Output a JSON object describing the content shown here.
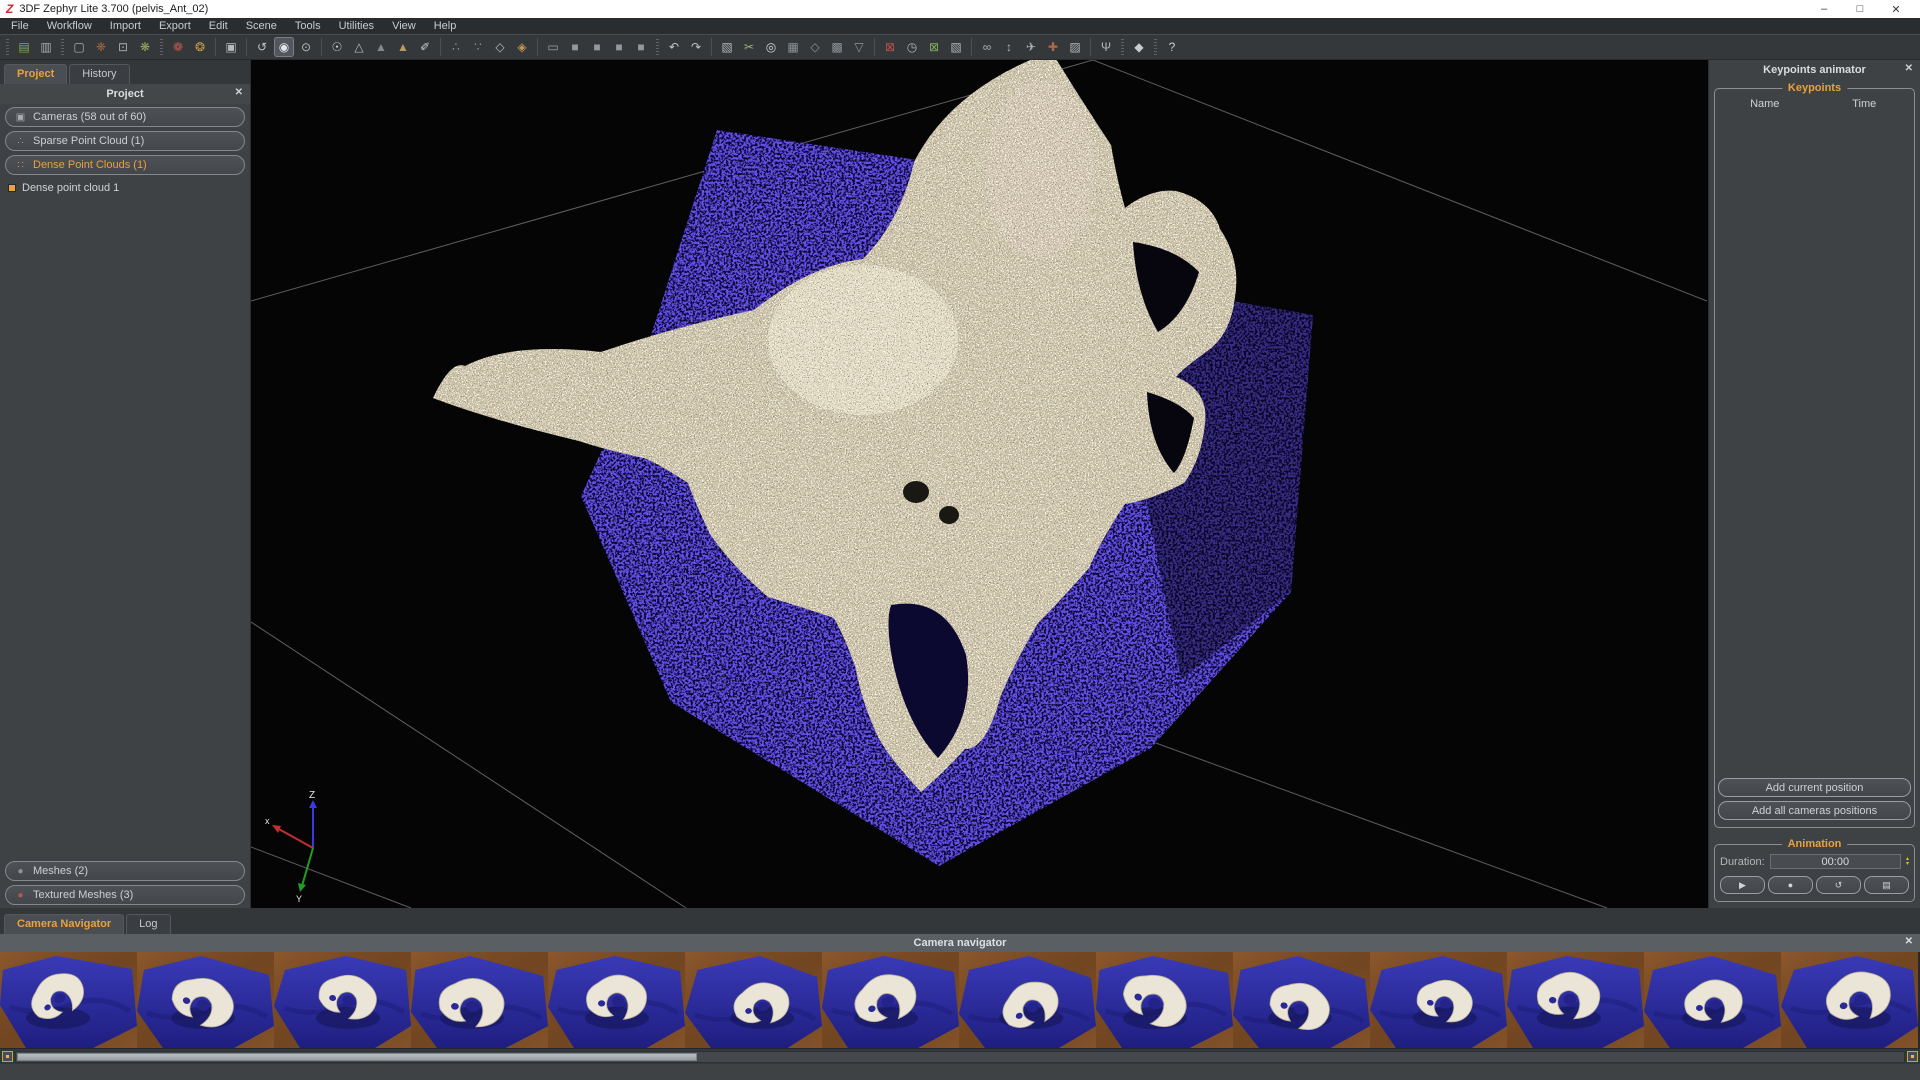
{
  "window": {
    "logo_text": "Z",
    "title": "3DF Zephyr Lite 3.700 (pelvis_Ant_02)",
    "minimize": "–",
    "restore": "□",
    "close": "✕"
  },
  "menu": {
    "items": [
      "File",
      "Workflow",
      "Import",
      "Export",
      "Edit",
      "Scene",
      "Tools",
      "Utilities",
      "View",
      "Help"
    ]
  },
  "toolbar": {
    "items": [
      {
        "type": "handle"
      },
      {
        "name": "open-project-icon",
        "glyph": "▤",
        "color": "#7fae5e"
      },
      {
        "name": "save-project-icon",
        "glyph": "▥",
        "color": "#a9adb0"
      },
      {
        "type": "handle"
      },
      {
        "name": "new-selection-icon",
        "glyph": "▢",
        "color": "#a9adb0"
      },
      {
        "name": "sparse-generation-icon",
        "glyph": "❈",
        "color": "#b9743f"
      },
      {
        "name": "dense-generation-icon",
        "glyph": "⊡",
        "color": "#a9adb0"
      },
      {
        "name": "mesh-generation-icon",
        "glyph": "❋",
        "color": "#97a85c"
      },
      {
        "type": "handle"
      },
      {
        "name": "texture-generation-icon",
        "glyph": "❁",
        "color": "#bf5a4a"
      },
      {
        "name": "stereo-pair-icon",
        "glyph": "❂",
        "color": "#c39a4a"
      },
      {
        "type": "sep"
      },
      {
        "name": "screenshot-camera-icon",
        "glyph": "▣",
        "color": "#b6babd"
      },
      {
        "type": "sep"
      },
      {
        "name": "rotate-view-icon",
        "glyph": "↺",
        "color": "#c0c4c7"
      },
      {
        "name": "orbit-mode-icon",
        "glyph": "◉",
        "color": "#e2e6e9",
        "active": true
      },
      {
        "name": "pan-mode-icon",
        "glyph": "⊙",
        "color": "#b6babd"
      },
      {
        "type": "sep"
      },
      {
        "name": "lightbulb-icon",
        "glyph": "☉",
        "color": "#c8cccf"
      },
      {
        "name": "render-points-icon",
        "glyph": "△",
        "color": "#b6babd"
      },
      {
        "name": "render-shaded-icon",
        "glyph": "▲",
        "color": "#85898d"
      },
      {
        "name": "render-textured-icon",
        "glyph": "▲",
        "color": "#bb9a64"
      },
      {
        "name": "draw-tool-icon",
        "glyph": "✐",
        "color": "#c8cccf"
      },
      {
        "type": "sep"
      },
      {
        "name": "point-filter-icon",
        "glyph": "∴",
        "color": "#8e9397"
      },
      {
        "name": "point-edit-icon",
        "glyph": "∵",
        "color": "#8e9397"
      },
      {
        "name": "bounding-box-icon",
        "glyph": "◇",
        "color": "#b6babd"
      },
      {
        "name": "colored-cube-icon",
        "glyph": "◈",
        "color": "#c09a50"
      },
      {
        "type": "sep"
      },
      {
        "name": "up-vector-icon",
        "glyph": "▭",
        "color": "#9aa0a4"
      },
      {
        "name": "layout-single-icon",
        "glyph": "■",
        "color": "#93989c"
      },
      {
        "name": "layout-two-icon",
        "glyph": "■",
        "color": "#93989c"
      },
      {
        "name": "layout-three-icon",
        "glyph": "■",
        "color": "#93989c"
      },
      {
        "name": "layout-four-icon",
        "glyph": "■",
        "color": "#93989c"
      },
      {
        "type": "handle"
      },
      {
        "name": "undo-icon",
        "glyph": "↶",
        "color": "#c0c4c7"
      },
      {
        "name": "redo-icon",
        "glyph": "↷",
        "color": "#c0c4c7"
      },
      {
        "type": "sep"
      },
      {
        "name": "select-rect-icon",
        "glyph": "▧",
        "color": "#b0b4b7"
      },
      {
        "name": "cut-selection-icon",
        "glyph": "✂",
        "color": "#9fb579"
      },
      {
        "name": "circle-tool-icon",
        "glyph": "◎",
        "color": "#d5d8da"
      },
      {
        "name": "select-grid-icon",
        "glyph": "▦",
        "color": "#8e9397"
      },
      {
        "name": "select-diamond-icon",
        "glyph": "◇",
        "color": "#8e9397"
      },
      {
        "name": "select-dense-icon",
        "glyph": "▩",
        "color": "#8e9397"
      },
      {
        "name": "select-triangle-icon",
        "glyph": "▽",
        "color": "#8e9397"
      },
      {
        "type": "sep"
      },
      {
        "name": "deselect-icon",
        "glyph": "⊠",
        "color": "#b65050"
      },
      {
        "name": "select-time-icon",
        "glyph": "◷",
        "color": "#b0b4b7"
      },
      {
        "name": "invert-selection-icon",
        "glyph": "⊠",
        "color": "#7fae5e"
      },
      {
        "name": "package-icon",
        "glyph": "▧",
        "color": "#b0b4b7"
      },
      {
        "type": "sep"
      },
      {
        "name": "lasso-icon",
        "glyph": "∞",
        "color": "#b0b4b7"
      },
      {
        "name": "pin-measure-icon",
        "glyph": "↕",
        "color": "#b0b4b7"
      },
      {
        "name": "flythrough-icon",
        "glyph": "✈",
        "color": "#b0b4b7"
      },
      {
        "name": "axes-icon",
        "glyph": "✚",
        "color": "#b06a4a"
      },
      {
        "name": "hatch-measure-icon",
        "glyph": "▨",
        "color": "#b0b4b7"
      },
      {
        "type": "sep"
      },
      {
        "name": "wrench-icon",
        "glyph": "Ψ",
        "color": "#b0b4b7"
      },
      {
        "type": "handle"
      },
      {
        "name": "viewer-icon",
        "glyph": "◆",
        "color": "#c8cccf"
      },
      {
        "type": "handle"
      },
      {
        "name": "help-icon",
        "glyph": "?",
        "color": "#c8cccf"
      }
    ]
  },
  "left_panel": {
    "tabs": [
      {
        "label": "Project",
        "active": true
      },
      {
        "label": "History",
        "active": false
      }
    ],
    "header": "Project",
    "close_glyph": "✕",
    "tree": [
      {
        "name": "cameras",
        "label": "Cameras (58 out of 60)",
        "icon": "camera-icon",
        "glyph": "▣",
        "color": "#a8acaf",
        "active": false
      },
      {
        "name": "sparse-point-cloud",
        "label": "Sparse Point Cloud (1)",
        "icon": "sparse-cloud-icon",
        "glyph": "∴",
        "color": "#9aa0a4",
        "active": false
      },
      {
        "name": "dense-point-clouds",
        "label": "Dense Point Clouds (1)",
        "icon": "dense-cloud-icon",
        "glyph": "∷",
        "color": "#c09a50",
        "active": true
      }
    ],
    "tree_child": {
      "label": "Dense point cloud 1"
    },
    "bottom_tree": [
      {
        "name": "meshes",
        "label": "Meshes (2)",
        "icon": "mesh-icon",
        "glyph": "●",
        "color": "#8e9397",
        "active": false
      },
      {
        "name": "textured-meshes",
        "label": "Textured Meshes (3)",
        "icon": "textured-mesh-icon",
        "glyph": "●",
        "color": "#b5574a",
        "active": false
      }
    ]
  },
  "viewport": {
    "axis_labels": {
      "x": "x",
      "y": "Y",
      "z": "Z"
    }
  },
  "right_panel": {
    "title": "Keypoints animator",
    "close_glyph": "✕",
    "keypoints": {
      "label": "Keypoints",
      "name_col": "Name",
      "time_col": "Time",
      "add_current": "Add current position",
      "add_all": "Add all cameras positions"
    },
    "animation": {
      "label": "Animation",
      "duration_label": "Duration:",
      "duration_value": "00:00",
      "spinner_up": "▴",
      "spinner_down": "▾",
      "buttons": [
        {
          "name": "play-button",
          "glyph": "▶"
        },
        {
          "name": "record-button",
          "glyph": "●"
        },
        {
          "name": "loop-button",
          "glyph": "↺"
        },
        {
          "name": "export-frames-button",
          "glyph": "▤"
        }
      ]
    }
  },
  "bottom_panel": {
    "tabs": [
      {
        "label": "Camera Navigator",
        "active": true
      },
      {
        "label": "Log",
        "active": false
      }
    ],
    "header": "Camera navigator",
    "close_glyph": "✕",
    "thumbnails": [
      {
        "name": "camera-thumbnail-1"
      },
      {
        "name": "camera-thumbnail-2"
      },
      {
        "name": "camera-thumbnail-3"
      },
      {
        "name": "camera-thumbnail-4"
      },
      {
        "name": "camera-thumbnail-5"
      },
      {
        "name": "camera-thumbnail-6"
      },
      {
        "name": "camera-thumbnail-7"
      },
      {
        "name": "camera-thumbnail-8"
      },
      {
        "name": "camera-thumbnail-9"
      },
      {
        "name": "camera-thumbnail-10"
      },
      {
        "name": "camera-thumbnail-11"
      },
      {
        "name": "camera-thumbnail-12"
      },
      {
        "name": "camera-thumbnail-13"
      },
      {
        "name": "camera-thumbnail-14"
      }
    ]
  },
  "colors": {
    "accent_orange": "#eaa13c",
    "viewport_background": "#050506",
    "cloth_blue": "#2a1fd0",
    "bone_ivory": "#d6ccb2",
    "panel_gray": "#3e4245",
    "titlebar_white": "#ffffff"
  }
}
